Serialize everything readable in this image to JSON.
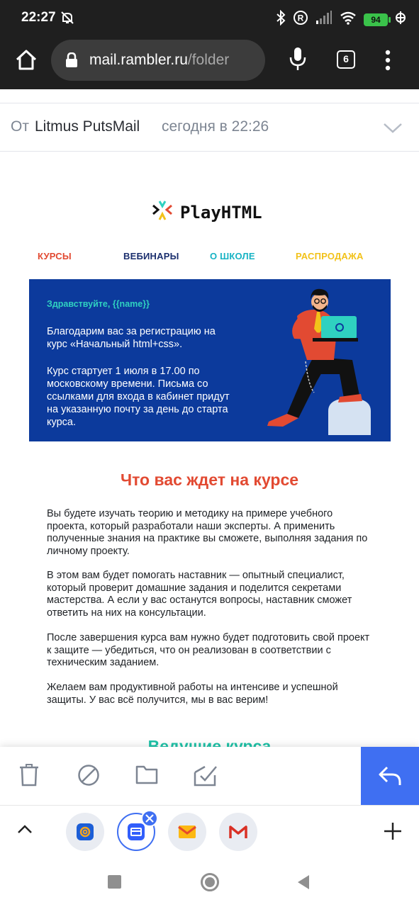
{
  "status_bar": {
    "time": "22:27",
    "battery_level": "94",
    "icons": [
      "mute-icon",
      "bluetooth-icon",
      "registered-icon",
      "signal-icon",
      "wifi-icon",
      "battery-icon",
      "charging-icon"
    ]
  },
  "browser": {
    "url_host": "mail.rambler.ru",
    "url_path": "/folder",
    "tab_count": "6"
  },
  "message_header": {
    "from_label": "От",
    "sender_name": "Litmus PutsMail",
    "date": "сегодня в 22:26"
  },
  "email": {
    "logo_text": "PlayHTML",
    "nav": [
      {
        "label": "КУРСЫ",
        "color": "#e24a32"
      },
      {
        "label": "ВЕБИНАРЫ",
        "color": "#1b2f6e"
      },
      {
        "label": "О ШКОЛЕ",
        "color": "#17b3c4"
      },
      {
        "label": "РАСПРОДАЖА",
        "color": "#f2c21a"
      }
    ],
    "banner": {
      "greeting": "Здравствуйте, {{name}}",
      "paragraph1": "Благодарим вас за регистрацию на курс «Начальный html+css».",
      "paragraph2": "Курс стартует 1 июля в 17.00 по московскому времени. Письма со ссылками для входа в кабинет придут на указанную почту за день до старта курса.",
      "background": "#0c3a9c"
    },
    "section_title": "Что вас ждет на курсе",
    "paragraphs": [
      "Вы будете изучать теорию и методику на примере учебного проекта, который разработали наши эксперты. А применить полученные знания на практике вы сможете, выполняя задания по личному проекту.",
      "В этом вам будет помогать наставник — опытный специалист, который проверит домашние задания и поделится секретами мастерства. А если у вас останутся вопросы, наставник сможет ответить на них на консультации.",
      "После завершения курса вам нужно будет подготовить свой проект к защите — убедиться, что он реализован в соответствии с техническим заданием.",
      "Желаем вам продуктивной работы на интенсиве и успешной защиты. У вас всё получится, мы в вас верим!"
    ],
    "next_section_title": "Ведущие курса"
  },
  "toolbar": {
    "actions": [
      "trash-icon",
      "spam-icon",
      "folder-icon",
      "mark-read-icon"
    ],
    "reply": "reply-icon",
    "accent": "#3f6ff2"
  },
  "app_switcher": {
    "apps": [
      "mail-ru-app-icon",
      "rambler-mail-app-icon",
      "yandex-mail-app-icon",
      "gmail-app-icon"
    ],
    "active_app": "rambler-mail-app-icon"
  }
}
